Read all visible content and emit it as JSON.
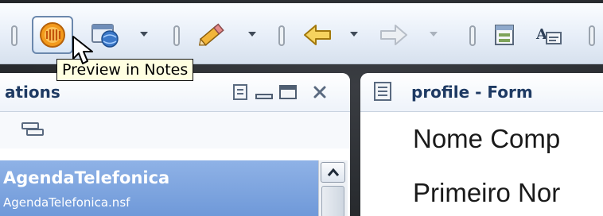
{
  "tooltip": {
    "text": "Preview in Notes"
  },
  "toolbar": {
    "buttons": [
      {
        "icon": "preview-in-notes-icon",
        "pressed": true
      },
      {
        "icon": "preview-in-browser-icon",
        "has_dropdown": true
      },
      {
        "icon": "design-pencil-icon",
        "has_dropdown": true
      },
      {
        "icon": "back-arrow-icon",
        "has_dropdown": true
      },
      {
        "icon": "forward-arrow-icon",
        "has_dropdown": true,
        "disabled": true
      },
      {
        "icon": "form-properties-icon"
      },
      {
        "icon": "text-properties-icon"
      }
    ]
  },
  "left_panel": {
    "title": "ations",
    "list_item": {
      "title": "AgendaTelefonica",
      "subtitle": "AgendaTelefonica.nsf"
    }
  },
  "right_panel": {
    "title": "profile - Form",
    "fields": [
      "Nome Comp",
      "Primeiro Nor"
    ]
  },
  "colors": {
    "selection": "#7aa2df",
    "header_text": "#1e3a63",
    "tooltip_bg": "#ffffe1"
  }
}
